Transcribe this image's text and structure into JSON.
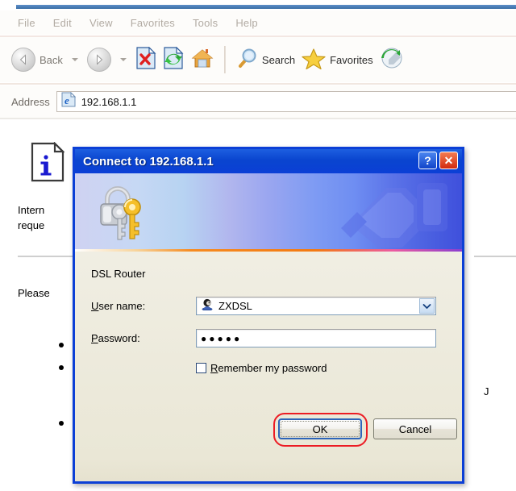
{
  "browser": {
    "menu": [
      "File",
      "Edit",
      "View",
      "Favorites",
      "Tools",
      "Help"
    ],
    "toolbar": {
      "back_label": "Back",
      "back_icon": "arrow-left-icon",
      "forward_icon": "arrow-right-icon",
      "stop_icon": "stop-page-icon",
      "refresh_icon": "refresh-icon",
      "home_icon": "home-icon",
      "search_label": "Search",
      "search_icon": "magnifier-icon",
      "favorites_label": "Favorites",
      "favorites_icon": "star-icon",
      "media_icon": "media-history-icon"
    },
    "address": {
      "label": "Address",
      "value": "192.168.1.1",
      "icon": "ie-page-icon"
    }
  },
  "page": {
    "info_icon": "information-page-icon",
    "line1": "Intern",
    "line2": "reque",
    "line3": "Please",
    "right_char": "J",
    "bullets": [
      "",
      "",
      ""
    ]
  },
  "dialog": {
    "title": "Connect to 192.168.1.1",
    "help_button": "?",
    "close_button": "✕",
    "banner_icon": "keys-padlock-icon",
    "realm": "DSL Router",
    "username": {
      "label_before": "",
      "label_accel": "U",
      "label_after": "ser name:",
      "value": "ZXDSL",
      "icon": "user-head-icon",
      "dropdown_icon": "chevron-down-icon"
    },
    "password": {
      "label_accel": "P",
      "label_after": "assword:",
      "value": "●●●●●"
    },
    "remember": {
      "label_accel": "R",
      "label_after": "emember my password",
      "checked": false
    },
    "ok_label": "OK",
    "cancel_label": "Cancel",
    "annotation_color": "#ec1c24"
  }
}
